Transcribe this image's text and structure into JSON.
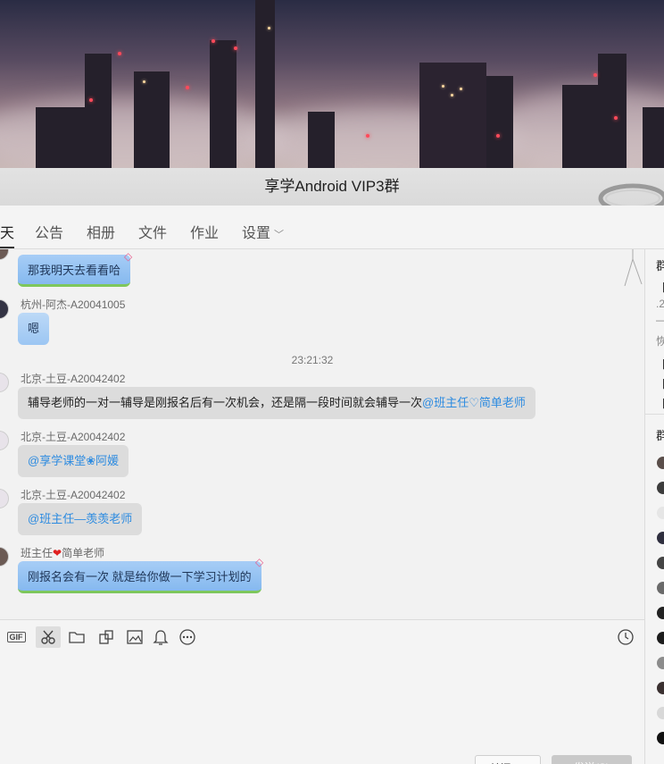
{
  "window": {
    "title": "享学Android  VIP3群"
  },
  "tabs": [
    {
      "label": "天"
    },
    {
      "label": "公告"
    },
    {
      "label": "相册"
    },
    {
      "label": "文件"
    },
    {
      "label": "作业"
    },
    {
      "label": "设置"
    }
  ],
  "chat": {
    "messages": [
      {
        "sender": "",
        "text": "那我明天去看看哈"
      },
      {
        "sender": "杭州-阿杰-A20041005",
        "text": "嗯"
      },
      {
        "sender": "北京-土豆-A20042402",
        "text_plain": "辅导老师的一对一辅导是刚报名后有一次机会，还是隔一段时间就会辅导一次",
        "mention": "@班主任♡简单老师"
      },
      {
        "sender": "北京-土豆-A20042402",
        "mention": "@享学课堂❀阿媛"
      },
      {
        "sender": "北京-土豆-A20042402",
        "mention": "@班主任—羡羡老师"
      },
      {
        "sender_prefix": "班主任",
        "sender_suffix": "简单老师",
        "text": "刚报名会有一次 就是给你做一下学习计划的"
      }
    ],
    "timestamp": "23:21:32"
  },
  "toolbar": {
    "gif_label": "GIF",
    "icons": [
      "gif-icon",
      "scissors-icon",
      "folder-icon",
      "dice-icon",
      "image-icon",
      "bell-icon",
      "more-icon",
      "clock-icon"
    ]
  },
  "input": {
    "close_label": "关闭(C)",
    "send_label": "发送(S)"
  },
  "right_panel": {
    "header1": "群",
    "lines": [
      "【/",
      ".2",
      "—",
      "恢",
      "【.",
      "【.",
      "【."
    ],
    "header2": "群"
  },
  "colors": {
    "bubble_blue": "#9cc6f3",
    "bubble_grey": "#dcdcdc",
    "mention": "#2d8be0"
  }
}
